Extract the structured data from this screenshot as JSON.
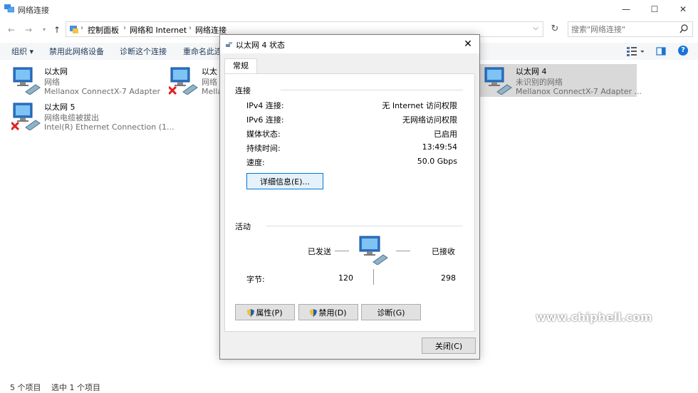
{
  "window": {
    "title": "网络连接",
    "controls": {
      "minimize": "—",
      "maximize": "☐",
      "close": "✕"
    }
  },
  "address": {
    "crumbs": [
      "控制面板",
      "网络和 Internet",
      "网络连接"
    ],
    "search_placeholder": "搜索\"网络连接\""
  },
  "toolbar": {
    "items": [
      "组织 ▾",
      "禁用此网络设备",
      "诊断这个连接",
      "重命名此连"
    ]
  },
  "connections": [
    {
      "name": "以太网",
      "status": "网络",
      "adapter": "Mellanox ConnectX-7 Adapter",
      "disconnected": false
    },
    {
      "name": "以太网 5",
      "status": "网络电缆被拔出",
      "adapter": "Intel(R) Ethernet Connection (1...",
      "disconnected": true
    },
    {
      "name": "以太",
      "status": "网络",
      "adapter": "Mella",
      "disconnected": true
    },
    {
      "name": "以太网 4",
      "status": "未识别的网络",
      "adapter": "Mellanox ConnectX-7 Adapter ...",
      "disconnected": false
    }
  ],
  "statusbar": {
    "count": "5 个项目",
    "selected": "选中 1 个项目"
  },
  "dialog": {
    "title": "以太网 4 状态",
    "tab": "常规",
    "connection_group": "连接",
    "rows": [
      {
        "label": "IPv4 连接:",
        "value": "无 Internet 访问权限"
      },
      {
        "label": "IPv6 连接:",
        "value": "无网络访问权限"
      },
      {
        "label": "媒体状态:",
        "value": "已启用"
      },
      {
        "label": "持续时间:",
        "value": "13:49:54"
      },
      {
        "label": "速度:",
        "value": "50.0 Gbps"
      }
    ],
    "details_button": "详细信息(E)...",
    "activity_group": "活动",
    "sent_label": "已发送",
    "received_label": "已接收",
    "bytes_label": "字节:",
    "bytes_sent": "120",
    "bytes_received": "298",
    "properties_button": "属性(P)",
    "disable_button": "禁用(D)",
    "diagnose_button": "诊断(G)",
    "close_button": "关闭(C)"
  },
  "watermark": "www.chiphell.com",
  "colors": {
    "accent": "#0078d7",
    "selected_bg": "#cce8ff",
    "toolbar_text": "#1e395b"
  }
}
